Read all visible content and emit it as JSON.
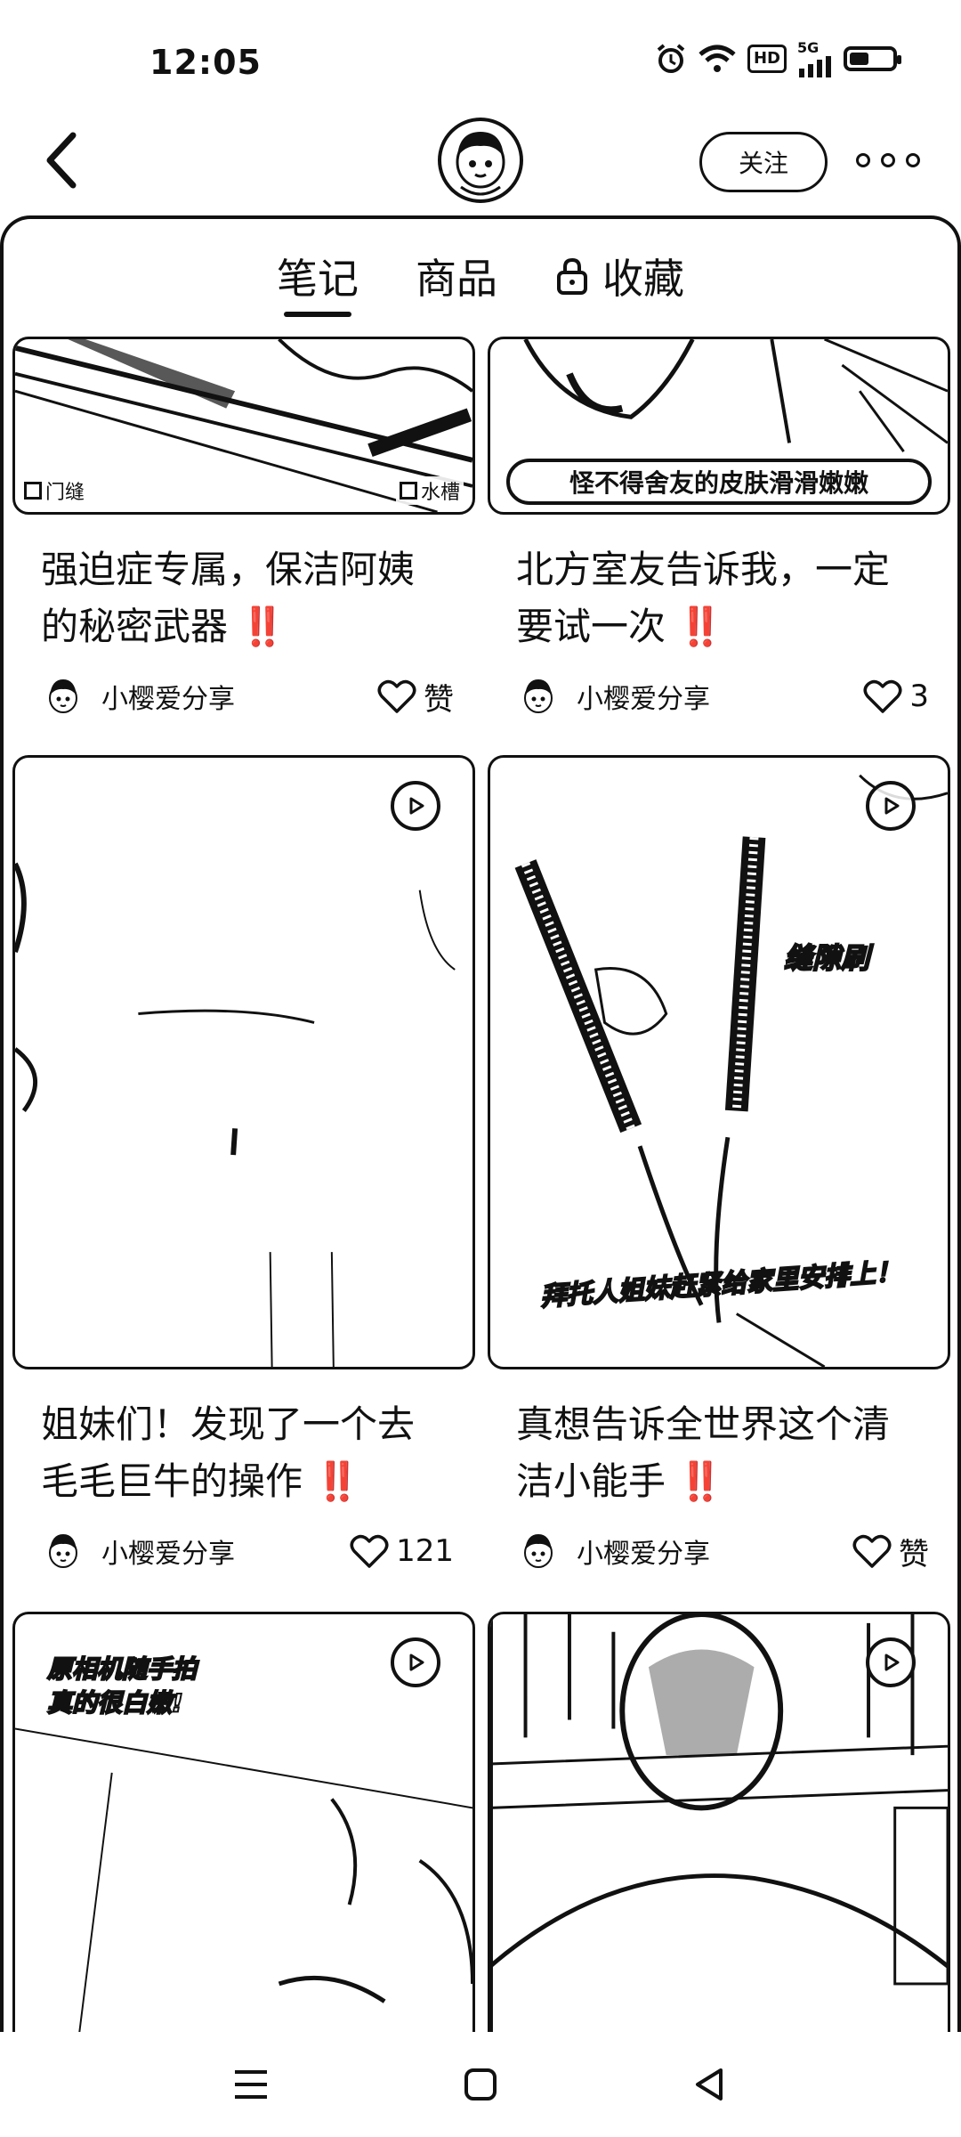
{
  "status_bar": {
    "time": "12:05",
    "icons": [
      "alarm-icon",
      "wifi-icon",
      "hd-icon",
      "5g-signal-icon",
      "battery-icon"
    ],
    "hd_label": "HD",
    "network_label": "5G",
    "battery_level": 0.45
  },
  "header": {
    "follow_label": "关注"
  },
  "tabs": [
    {
      "label": "笔记",
      "active": true
    },
    {
      "label": "商品",
      "active": false
    },
    {
      "label": "收藏",
      "active": false,
      "locked": true
    }
  ],
  "feed": [
    {
      "title": "强迫症专属，保洁阿姨的秘密武器 ‼️",
      "author": "小樱爱分享",
      "likes": "赞",
      "overlay": [
        "门缝",
        "水槽"
      ],
      "video": false
    },
    {
      "title": "北方室友告诉我，一定要试一次 ‼️",
      "author": "小樱爱分享",
      "likes": "3",
      "overlay": [
        "怪不得舍友的皮肤滑滑嫩嫩"
      ],
      "video": false
    },
    {
      "title": "姐妹们！发现了一个去毛毛巨牛的操作 ‼️",
      "author": "小樱爱分享",
      "likes": "121",
      "overlay": [],
      "video": true
    },
    {
      "title": "真想告诉全世界这个清洁小能手 ‼️",
      "author": "小樱爱分享",
      "likes": "赞",
      "overlay": [
        "缝隙刷",
        "拜托人姐妹赶紧给家里安排上！"
      ],
      "video": true
    },
    {
      "title": "",
      "author": "",
      "likes": "",
      "overlay": [
        "原相机随手拍",
        "真的很白嫩!"
      ],
      "video": true
    },
    {
      "title": "",
      "author": "",
      "likes": "",
      "overlay": [],
      "video": true
    }
  ],
  "nav": [
    "menu-icon",
    "home-icon",
    "back-icon"
  ]
}
